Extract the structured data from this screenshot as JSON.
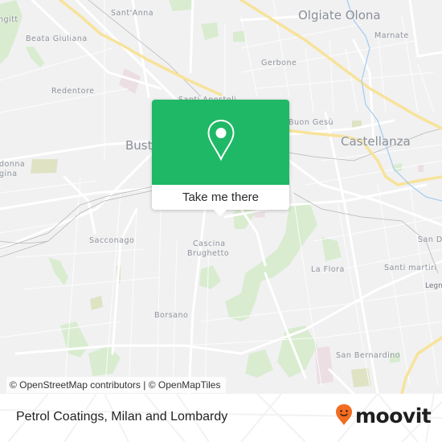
{
  "map": {
    "background_color": "#f1f1f2",
    "road_color": "#ffffff",
    "highway_color": "#f7e39a",
    "park_color": "#d9ecd0",
    "water_color": "#a9cdef",
    "places": [
      {
        "id": "olgiate-olona",
        "label": "Olgiate Olona",
        "kind": "city"
      },
      {
        "id": "castellanza",
        "label": "Castellanza",
        "kind": "city"
      },
      {
        "id": "busto",
        "label": "Busto",
        "kind": "city"
      },
      {
        "id": "santanna",
        "label": "Sant'Anna",
        "kind": "neighborhood"
      },
      {
        "id": "beata-giuliana",
        "label": "Beata Giuliana",
        "kind": "neighborhood"
      },
      {
        "id": "redentore",
        "label": "Redentore",
        "kind": "neighborhood"
      },
      {
        "id": "marnate",
        "label": "Marnate",
        "kind": "neighborhood"
      },
      {
        "id": "gerbone",
        "label": "Gerbone",
        "kind": "neighborhood"
      },
      {
        "id": "santi-apostoli",
        "label": "Santi Apostoli",
        "kind": "neighborhood"
      },
      {
        "id": "buon-gesu",
        "label": "Buon Gesù",
        "kind": "neighborhood"
      },
      {
        "id": "madonna-regina-1",
        "label": "donna",
        "kind": "neighborhood"
      },
      {
        "id": "madonna-regina-2",
        "label": "gina",
        "kind": "neighborhood"
      },
      {
        "id": "ngitt",
        "label": "ngitt",
        "kind": "neighborhood"
      },
      {
        "id": "sacconago",
        "label": "Sacconago",
        "kind": "neighborhood"
      },
      {
        "id": "cascina",
        "label": "Cascina",
        "kind": "neighborhood"
      },
      {
        "id": "brughetto",
        "label": "Brughetto",
        "kind": "neighborhood"
      },
      {
        "id": "la-flora",
        "label": "La Flora",
        "kind": "neighborhood"
      },
      {
        "id": "santi-martiri",
        "label": "Santi martiri",
        "kind": "neighborhood"
      },
      {
        "id": "san-d",
        "label": "San D",
        "kind": "neighborhood"
      },
      {
        "id": "legna",
        "label": "Legna",
        "kind": "town"
      },
      {
        "id": "borsano",
        "label": "Borsano",
        "kind": "neighborhood"
      },
      {
        "id": "san-bernardino",
        "label": "San Bernardino",
        "kind": "neighborhood"
      }
    ],
    "attribution": "© OpenStreetMap contributors | © OpenMapTiles"
  },
  "popup": {
    "icon": "map-pin-icon",
    "color": "#1fb866",
    "cta_label": "Take me there"
  },
  "footer": {
    "title": "Petrol Coatings, Milan and Lombardy",
    "logo_text": "moovit",
    "logo_color": "#f26c21"
  }
}
